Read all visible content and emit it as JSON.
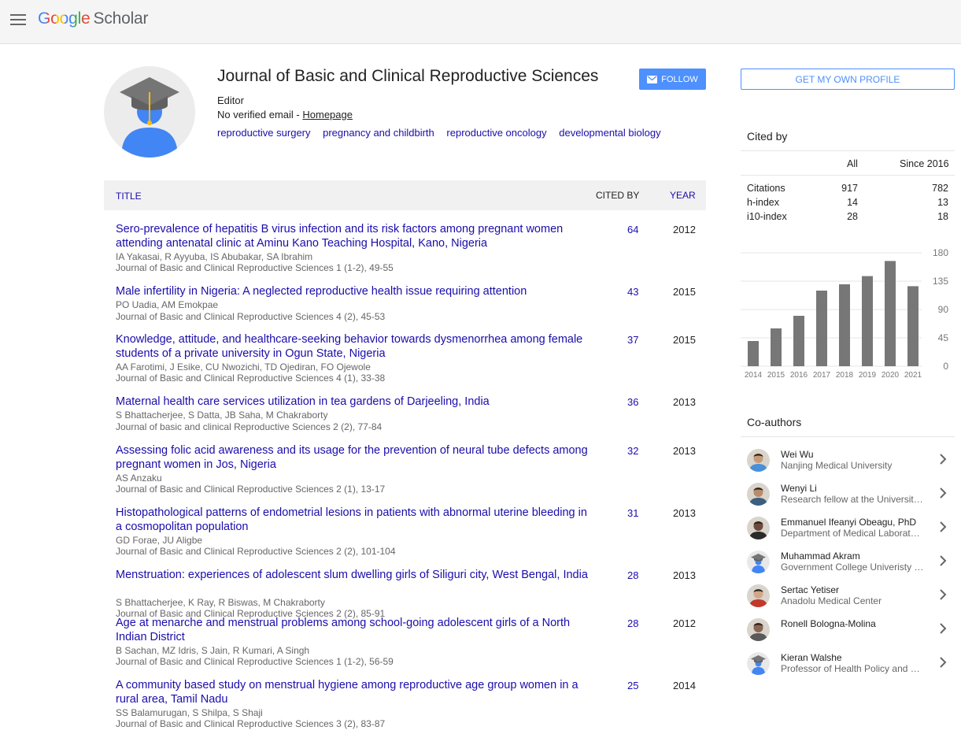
{
  "header": {
    "logo_google": "Google",
    "logo_scholar": "Scholar"
  },
  "profile": {
    "name": "Journal of Basic and Clinical Reproductive Sciences",
    "affiliation": "Editor",
    "email_text": "No verified email - ",
    "homepage_label": "Homepage",
    "interests": [
      "reproductive surgery",
      "pregnancy and childbirth",
      "reproductive oncology",
      "developmental biology"
    ],
    "follow_label": "FOLLOW"
  },
  "table": {
    "col_title": "TITLE",
    "col_cited": "CITED BY",
    "col_year": "YEAR",
    "rows": [
      {
        "title": "Sero-prevalence of hepatitis B virus infection and its risk factors among pregnant women attending antenatal clinic at Aminu Kano Teaching Hospital, Kano, Nigeria",
        "authors": "IA Yakasai, R Ayyuba, IS Abubakar, SA Ibrahim",
        "venue": "Journal of Basic and Clinical Reproductive Sciences 1 (1-2), 49-55",
        "cited": "64",
        "year": "2012"
      },
      {
        "title": "Male infertility in Nigeria: A neglected reproductive health issue requiring attention",
        "authors": "PO Uadia, AM Emokpae",
        "venue": "Journal of Basic and Clinical Reproductive Sciences 4 (2), 45-53",
        "cited": "43",
        "year": "2015"
      },
      {
        "title": "Knowledge, attitude, and healthcare-seeking behavior towards dysmenorrhea among female students of a private university in Ogun State, Nigeria",
        "authors": "AA Farotimi, J Esike, CU Nwozichi, TD Ojediran, FO Ojewole",
        "venue": "Journal of Basic and Clinical Reproductive Sciences 4 (1), 33-38",
        "cited": "37",
        "year": "2015"
      },
      {
        "title": "Maternal health care services utilization in tea gardens of Darjeeling, India",
        "authors": "S Bhattacherjee, S Datta, JB Saha, M Chakraborty",
        "venue": "Journal of basic and clinical Reproductive Sciences 2 (2), 77-84",
        "cited": "36",
        "year": "2013"
      },
      {
        "title": "Assessing folic acid awareness and its usage for the prevention of neural tube defects among pregnant women in Jos, Nigeria",
        "authors": "AS Anzaku",
        "venue": "Journal of Basic and Clinical Reproductive Sciences 2 (1), 13-17",
        "cited": "32",
        "year": "2013"
      },
      {
        "title": "Histopathological patterns of endometrial lesions in patients with abnormal uterine bleeding in a cosmopolitan population",
        "authors": "GD Forae, JU Aligbe",
        "venue": "Journal of Basic and Clinical Reproductive Sciences 2 (2), 101-104",
        "cited": "31",
        "year": "2013"
      },
      {
        "title": "Menstruation: experiences of adolescent slum dwelling girls of Siliguri city, West Bengal, India",
        "authors": "S Bhattacherjee, K Ray, R Biswas, M Chakraborty",
        "venue": "Journal of Basic and Clinical Reproductive Sciences 2 (2), 85-91",
        "cited": "28",
        "year": "2013"
      },
      {
        "title": "Age at menarche and menstrual problems among school-going adolescent girls of a North Indian District",
        "authors": "B Sachan, MZ Idris, S Jain, R Kumari, A Singh",
        "venue": "Journal of Basic and Clinical Reproductive Sciences 1 (1-2), 56-59",
        "cited": "28",
        "year": "2012"
      },
      {
        "title": "A community based study on menstrual hygiene among reproductive age group women in a rural area, Tamil Nadu",
        "authors": "SS Balamurugan, S Shilpa, S Shaji",
        "venue": "Journal of Basic and Clinical Reproductive Sciences 3 (2), 83-87",
        "cited": "25",
        "year": "2014"
      }
    ]
  },
  "sidebar": {
    "get_profile_label": "GET MY OWN PROFILE",
    "cited_by_heading": "Cited by",
    "col_all": "All",
    "col_since": "Since 2016",
    "metrics": [
      {
        "label": "Citations",
        "all": "917",
        "since": "782"
      },
      {
        "label": "h-index",
        "all": "14",
        "since": "13"
      },
      {
        "label": "i10-index",
        "all": "28",
        "since": "18"
      }
    ],
    "coauthors_heading": "Co-authors",
    "coauthors": [
      {
        "name": "Wei Wu",
        "affiliation": "Nanjing Medical University",
        "avatar": "photo"
      },
      {
        "name": "Wenyi Li",
        "affiliation": "Research fellow at the University of Melbourne",
        "avatar": "photo"
      },
      {
        "name": "Emmanuel Ifeanyi Obeagu, PhD",
        "affiliation": "Department of Medical Laboratory Science",
        "avatar": "photo"
      },
      {
        "name": "Muhammad Akram",
        "affiliation": "Government College Univeristy Faisalabad",
        "avatar": "default"
      },
      {
        "name": "Sertac Yetiser",
        "affiliation": "Anadolu Medical Center",
        "avatar": "photo"
      },
      {
        "name": "Ronell Bologna-Molina",
        "affiliation": "",
        "avatar": "photo"
      },
      {
        "name": "Kieran Walshe",
        "affiliation": "Professor of Health Policy and Management",
        "avatar": "default"
      }
    ]
  },
  "chart_data": {
    "type": "bar",
    "categories": [
      "2014",
      "2015",
      "2016",
      "2017",
      "2018",
      "2019",
      "2020",
      "2021"
    ],
    "values": [
      40,
      60,
      80,
      120,
      130,
      143,
      167,
      127
    ],
    "ylim": [
      0,
      180
    ],
    "yticks": [
      "180",
      "135",
      "90",
      "45",
      "0"
    ],
    "grid": true,
    "bar_color": "#777777"
  }
}
